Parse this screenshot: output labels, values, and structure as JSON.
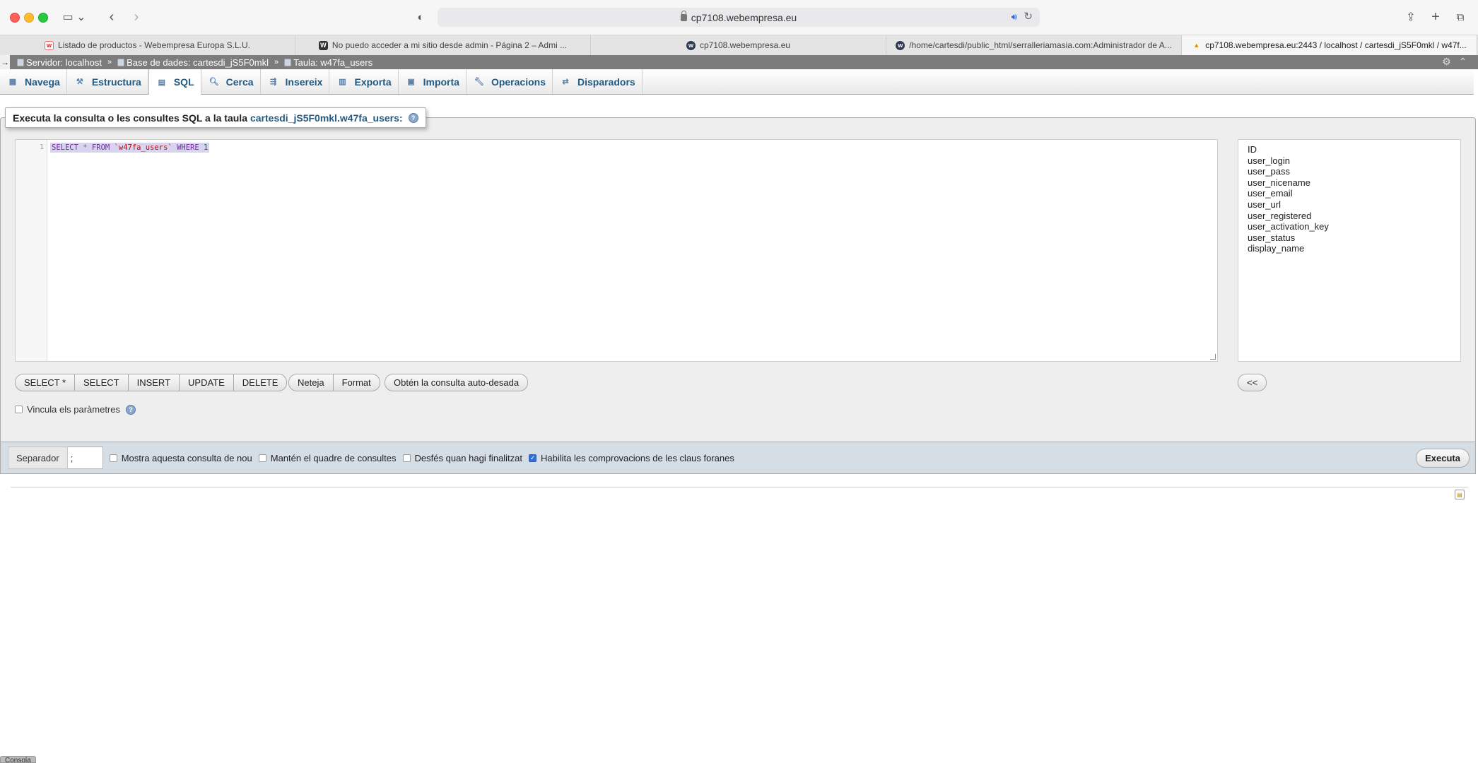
{
  "browser": {
    "url": "cp7108.webempresa.eu",
    "tabs": [
      {
        "title": "Listado de productos - Webempresa Europa S.L.U.",
        "favicon": "webempresa-icon"
      },
      {
        "title": "No puedo acceder a mi sitio desde admin - Página 2 – Admi ...",
        "favicon": "wordpress-forum-icon"
      },
      {
        "title": "cp7108.webempresa.eu",
        "favicon": "cpanel-icon"
      },
      {
        "title": "/home/cartesdi/public_html/serralleriamasia.com:Administrador de A...",
        "favicon": "cpanel-icon"
      },
      {
        "title": "cp7108.webempresa.eu:2443 / localhost / cartesdi_jS5F0mkl / w47f...",
        "favicon": "phpmyadmin-icon"
      }
    ]
  },
  "breadcrumb": {
    "server": "Servidor: localhost",
    "database": "Base de dades: cartesdi_jS5F0mkl",
    "table": "Taula: w47fa_users",
    "separator": "»"
  },
  "menu": [
    "Navega",
    "Estructura",
    "SQL",
    "Cerca",
    "Insereix",
    "Exporta",
    "Importa",
    "Operacions",
    "Disparadors"
  ],
  "sql_panel": {
    "legend_text": "Executa la consulta o les consultes SQL a la taula",
    "legend_table": "cartesdi_jS5F0mkl.w47fa_users:",
    "line_number": "1",
    "query_parts": {
      "select": "SELECT",
      "star": "*",
      "from": "FROM",
      "table": "`w47fa_users`",
      "where": "WHERE",
      "value": "1"
    },
    "fields": [
      "ID",
      "user_login",
      "user_pass",
      "user_nicename",
      "user_email",
      "user_url",
      "user_registered",
      "user_activation_key",
      "user_status",
      "display_name"
    ],
    "buttons_group1": [
      "SELECT *",
      "SELECT",
      "INSERT",
      "UPDATE",
      "DELETE"
    ],
    "buttons_group2": [
      "Neteja",
      "Format"
    ],
    "button_auto": "Obtén la consulta auto-desada",
    "insert_field_button": "<<",
    "bind_params": "Vincula els paràmetres"
  },
  "footer": {
    "separator_label": "Separador",
    "separator_value": ";",
    "options": [
      {
        "label": "Mostra aquesta consulta de nou",
        "checked": false
      },
      {
        "label": "Mantén el quadre de consultes",
        "checked": false
      },
      {
        "label": "Desfés quan hagi finalitzat",
        "checked": false
      },
      {
        "label": "Habilita les comprovacions de les claus foranes",
        "checked": true
      }
    ],
    "execute": "Executa"
  },
  "console_label": "Consola"
}
